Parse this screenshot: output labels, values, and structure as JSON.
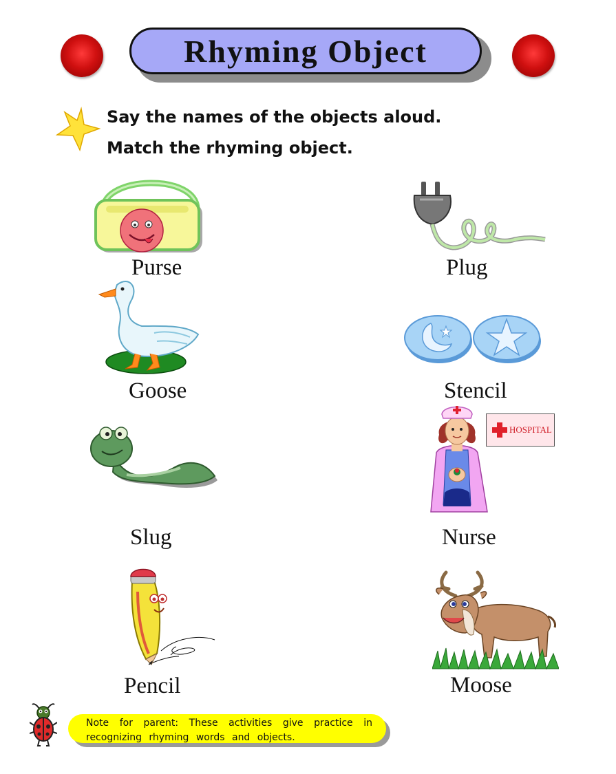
{
  "title": "Rhyming Object",
  "instructions": [
    "Say the names of the objects aloud.",
    "Match the rhyming object."
  ],
  "left_column": [
    {
      "word": "Purse",
      "icon": "purse-icon"
    },
    {
      "word": "Goose",
      "icon": "goose-icon"
    },
    {
      "word": "Slug",
      "icon": "slug-icon"
    },
    {
      "word": "Pencil",
      "icon": "pencil-icon"
    }
  ],
  "right_column": [
    {
      "word": "Plug",
      "icon": "plug-icon"
    },
    {
      "word": "Stencil",
      "icon": "stencil-icon"
    },
    {
      "word": "Nurse",
      "icon": "nurse-icon"
    },
    {
      "word": "Moose",
      "icon": "moose-icon"
    }
  ],
  "hospital_sign": "HOSPITAL",
  "note": {
    "line1": "Note for parent: These activities give practice in",
    "line2": "recognizing rhyming words and objects."
  },
  "colors": {
    "title_pill": "#a6a8f7",
    "ball": "#d01010",
    "star": "#ffe23a",
    "note": "#ffff00"
  }
}
